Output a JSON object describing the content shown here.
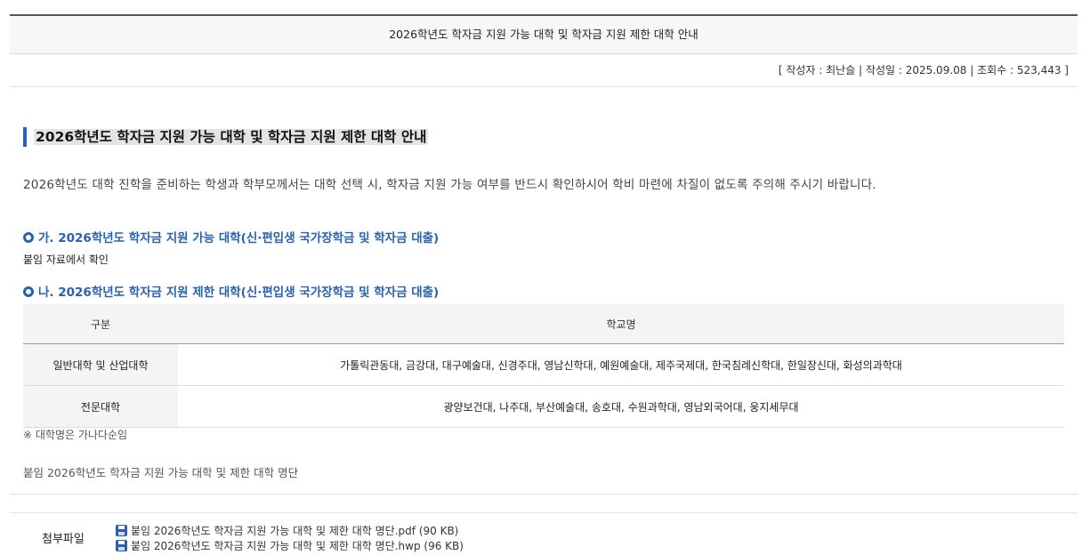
{
  "header": {
    "title": "2026학년도 학자금 지원 가능 대학 및 학자금 지원 제한 대학 안내",
    "meta": "[ 작성자 : 최난슬 | 작성일 : 2025.09.08 | 조회수 : 523,443 ]"
  },
  "body": {
    "section_title": "2026학년도 학자금 지원 가능 대학 및 학자금 지원 제한 대학 안내",
    "intro": "2026학년도 대학 진학을 준비하는 학생과 학부모께서는 대학 선택 시, 학자금 지원 가능 여부를 반드시 확인하시어 학비 마련에 차질이 없도록 주의해 주시기 바랍니다.",
    "sub_a": "가. 2026학년도 학자금 지원 가능 대학(신·편입생 국가장학금 및 학자금 대출)",
    "sub_a_note": "붙임 자료에서 확인",
    "sub_b": "나. 2026학년도 학자금 지원 제한 대학(신·편입생 국가장학금 및 학자금 대출)",
    "table": {
      "headers": [
        "구분",
        "학교명"
      ],
      "rows": [
        {
          "category": "일반대학 및 산업대학",
          "schools": "가톨릭관동대, 금강대, 대구예술대, 신경주대, 영남신학대, 예원예술대, 제주국제대, 한국침례신학대, 한일장신대, 화성의과학대"
        },
        {
          "category": "전문대학",
          "schools": "광양보건대, 나주대, 부산예술대, 송호대, 수원과학대, 영남외국어대, 웅지세무대"
        }
      ]
    },
    "footnote": "※ 대학명은 가나다순임",
    "attachment_note": "붙임 2026학년도 학자금 지원 가능 대학 및 제한 대학 명단"
  },
  "attachments": {
    "label": "첨부파일",
    "files": [
      {
        "name": "붙임 2026학년도 학자금 지원 가능 대학 및 제한 대학 명단.pdf",
        "size": "(90 KB)",
        "icon": "floppy-disk-icon"
      },
      {
        "name": "붙임 2026학년도 학자금 지원 가능 대학 및 제한 대학 명단.hwp",
        "size": "(96 KB)",
        "icon": "floppy-disk-icon"
      }
    ]
  },
  "colors": {
    "accent": "#2a62b0",
    "header_bg": "#f7f7f7",
    "table_label_bg": "#f4f4f4"
  }
}
